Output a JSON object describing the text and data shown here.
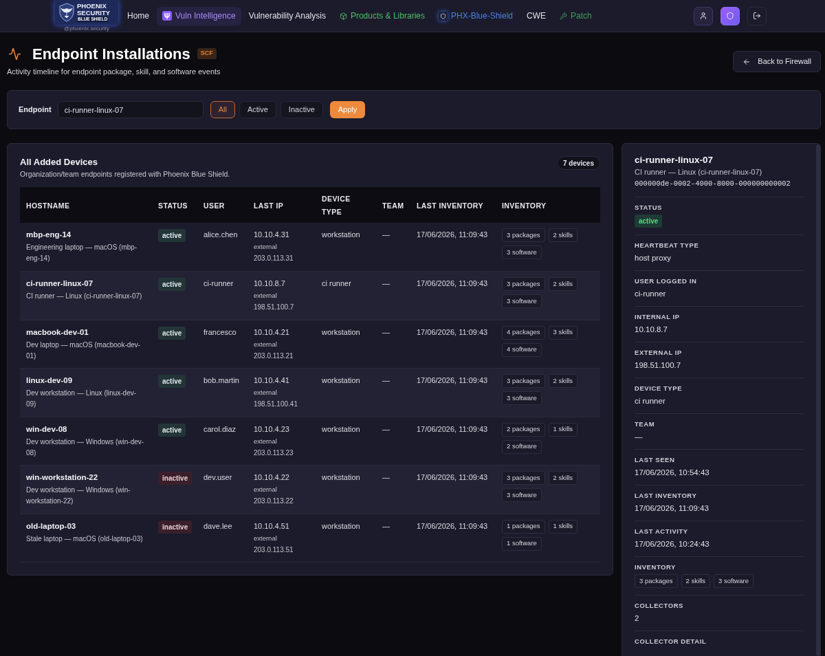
{
  "nav": {
    "logo": {
      "lines": [
        "PHOENIX",
        "SECURITY",
        "BLUE SHIELD"
      ],
      "handle": "@phoenix.security"
    },
    "items": [
      {
        "label": "Home",
        "kind": "plain",
        "selected": false
      },
      {
        "label": "Vuln Intelligence",
        "kind": "intel",
        "selected": true
      },
      {
        "label": "Vulnerability Analysis",
        "kind": "plain",
        "selected": false
      },
      {
        "label": "Products & Libraries",
        "kind": "catalog",
        "selected": false,
        "color": "#4fbf63"
      },
      {
        "label": "PHX-Blue-Shield",
        "kind": "agent",
        "selected": false,
        "color": "#4d7fe6"
      },
      {
        "label": "CWE",
        "kind": "plain",
        "selected": false
      },
      {
        "label": "Patch",
        "kind": "tool",
        "selected": false,
        "color": "#3f9f5a"
      }
    ],
    "actions": [
      {
        "kind": "profile",
        "selected": false
      },
      {
        "kind": "shield",
        "selected": true
      },
      {
        "kind": "logout",
        "selected": false
      }
    ]
  },
  "page_header": {
    "title": "Endpoint Installations",
    "badge": "SCF",
    "subtitle": "Activity timeline for endpoint package, skill, and software events",
    "back_button": "Back to Firewall"
  },
  "filter": {
    "label": "Endpoint",
    "value": "ci-runner-linux-07",
    "options": [
      {
        "label": "All",
        "selected": true
      },
      {
        "label": "Active",
        "selected": false
      },
      {
        "label": "Inactive",
        "selected": false
      }
    ],
    "apply": "Apply"
  },
  "devices": {
    "title": "All Added Devices",
    "subtitle": "Organization/team endpoints registered with Phoenix Blue Shield.",
    "count": "7 devices",
    "columns": [
      "HOSTNAME",
      "STATUS",
      "USER",
      "LAST IP",
      "DEVICE TYPE",
      "TEAM",
      "LAST INVENTORY",
      "INVENTORY"
    ],
    "rows": [
      {
        "hostname": "mbp-eng-14",
        "description": "Engineering laptop — macOS (mbp-eng-14)",
        "status": "active",
        "active": true,
        "user": "alice.chen",
        "ip": "10.10.4.31",
        "ip_label": "external",
        "external_ip": "203.0.113.31",
        "device_type": "workstation",
        "team": "—",
        "last_inventory": "17/06/2026, 11:09:43",
        "inventory": [
          "3 packages",
          "2 skills",
          "3 software"
        ]
      },
      {
        "hostname": "ci-runner-linux-07",
        "description": "CI runner — Linux (ci-runner-linux-07)",
        "status": "active",
        "active": true,
        "user": "ci-runner",
        "ip": "10.10.8.7",
        "ip_label": "external",
        "external_ip": "198.51.100.7",
        "device_type": "ci runner",
        "team": "—",
        "last_inventory": "17/06/2026, 11:09:43",
        "inventory": [
          "3 packages",
          "2 skills",
          "3 software"
        ]
      },
      {
        "hostname": "macbook-dev-01",
        "description": "Dev laptop — macOS (macbook-dev-01)",
        "status": "active",
        "active": true,
        "user": "francesco",
        "ip": "10.10.4.21",
        "ip_label": "external",
        "external_ip": "203.0.113.21",
        "device_type": "workstation",
        "team": "—",
        "last_inventory": "17/06/2026, 11:09:43",
        "inventory": [
          "4 packages",
          "3 skills",
          "4 software"
        ]
      },
      {
        "hostname": "linux-dev-09",
        "description": "Dev workstation — Linux (linux-dev-09)",
        "status": "active",
        "active": true,
        "user": "bob.martin",
        "ip": "10.10.4.41",
        "ip_label": "external",
        "external_ip": "198.51.100.41",
        "device_type": "workstation",
        "team": "—",
        "last_inventory": "17/06/2026, 11:09:43",
        "inventory": [
          "3 packages",
          "2 skills",
          "3 software"
        ]
      },
      {
        "hostname": "win-dev-08",
        "description": "Dev workstation — Windows (win-dev-08)",
        "status": "active",
        "active": true,
        "user": "carol.diaz",
        "ip": "10.10.4.23",
        "ip_label": "external",
        "external_ip": "203.0.113.23",
        "device_type": "workstation",
        "team": "—",
        "last_inventory": "17/06/2026, 11:09:43",
        "inventory": [
          "2 packages",
          "1 skills",
          "2 software"
        ]
      },
      {
        "hostname": "win-workstation-22",
        "description": "Dev workstation — Windows (win-workstation-22)",
        "status": "inactive",
        "active": false,
        "user": "dev.user",
        "ip": "10.10.4.22",
        "ip_label": "external",
        "external_ip": "203.0.113.22",
        "device_type": "workstation",
        "team": "—",
        "last_inventory": "17/06/2026, 11:09:43",
        "inventory": [
          "3 packages",
          "2 skills",
          "3 software"
        ]
      },
      {
        "hostname": "old-laptop-03",
        "description": "Stale laptop — macOS (old-laptop-03)",
        "status": "inactive",
        "active": false,
        "user": "dave.lee",
        "ip": "10.10.4.51",
        "ip_label": "external",
        "external_ip": "203.0.113.51",
        "device_type": "workstation",
        "team": "—",
        "last_inventory": "17/06/2026, 11:09:43",
        "inventory": [
          "1 packages",
          "1 skills",
          "1 software"
        ]
      }
    ]
  },
  "detail": {
    "title": "ci-runner-linux-07",
    "subtitle": "CI runner — Linux (ci-runner-linux-07)",
    "id": "000000de-0002-4000-8000-000000000002",
    "fields": [
      {
        "label": "STATUS",
        "kind": "badge",
        "value": "active",
        "active": true
      },
      {
        "label": "HEARTBEAT TYPE",
        "kind": "text",
        "value": "host proxy"
      },
      {
        "label": "USER LOGGED IN",
        "kind": "text",
        "value": "ci-runner"
      },
      {
        "label": "INTERNAL IP",
        "kind": "text",
        "value": "10.10.8.7"
      },
      {
        "label": "EXTERNAL IP",
        "kind": "text",
        "value": "198.51.100.7"
      },
      {
        "label": "DEVICE TYPE",
        "kind": "text",
        "value": "ci runner"
      },
      {
        "label": "TEAM",
        "kind": "text",
        "value": "—"
      },
      {
        "label": "LAST SEEN",
        "kind": "text",
        "value": "17/06/2026, 10:54:43"
      },
      {
        "label": "LAST INVENTORY",
        "kind": "text",
        "value": "17/06/2026, 11:09:43"
      },
      {
        "label": "LAST ACTIVITY",
        "kind": "text",
        "value": "17/06/2026, 10:24:43"
      },
      {
        "label": "INVENTORY",
        "kind": "tags",
        "tags": [
          "3 packages",
          "2 skills",
          "3 software"
        ]
      },
      {
        "label": "COLLECTORS",
        "kind": "text",
        "value": "2"
      },
      {
        "label": "COLLECTOR DETAIL",
        "kind": "text"
      }
    ]
  }
}
